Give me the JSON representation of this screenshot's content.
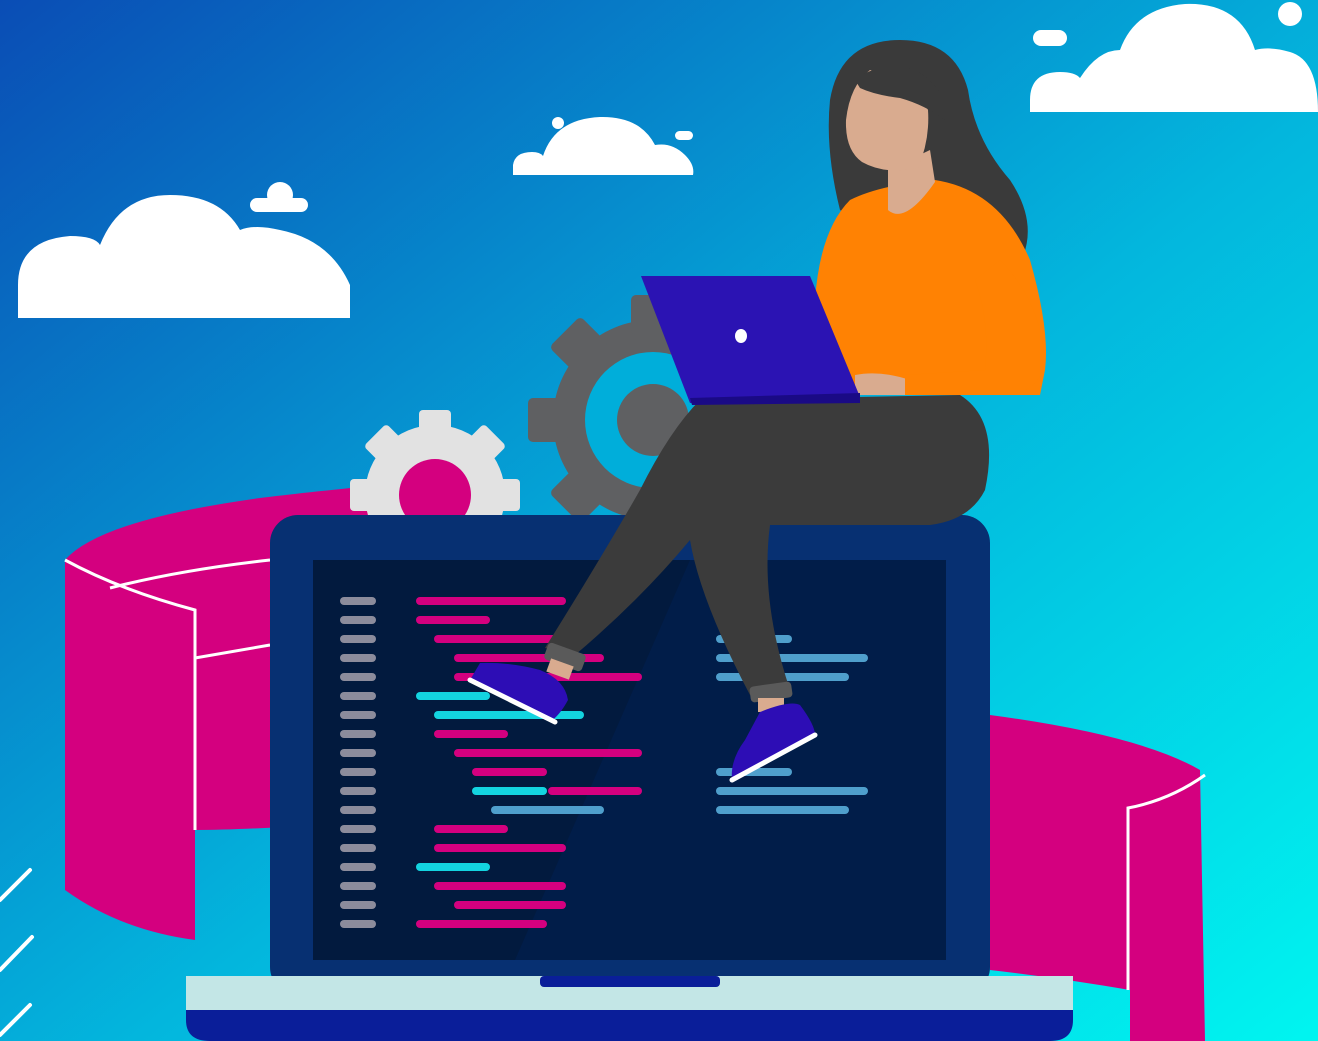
{
  "scene": {
    "description_tags": [
      "illustration",
      "developer-on-laptop"
    ],
    "colors": {
      "bg_start": "#0a52b8",
      "bg_end": "#00f2ef",
      "ribbon": "#d4007f",
      "cloud": "#ffffff",
      "laptop_bezel": "#073072",
      "screen": "#021a3e",
      "laptop_base": "#c3e6e6",
      "laptop_base_bottom": "#0a1e99",
      "gear_light": "#e2e2e2",
      "gear_dark": "#5a5a5a",
      "gear_center": "#00aeda",
      "shirt": "#ff8203",
      "pants": "#3b3b3b",
      "skin": "#d9ab8f",
      "hair": "#3a3a3a",
      "small_laptop": "#2b13b3",
      "shoe": "#2d0db5",
      "code_gray": "#8c8c9c",
      "code_pink": "#d4007f",
      "code_cyan": "#13d4e0",
      "code_blue": "#4f9fcc"
    },
    "icons": [
      "cloud-icon",
      "gear-icon",
      "laptop-icon"
    ]
  }
}
